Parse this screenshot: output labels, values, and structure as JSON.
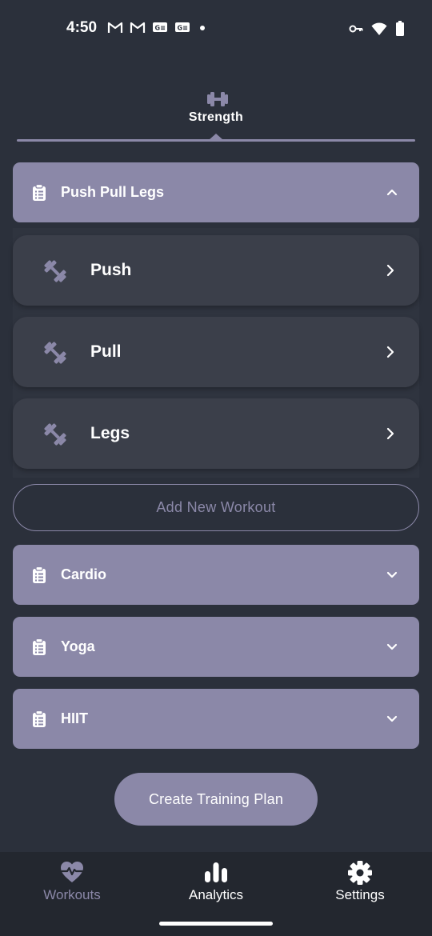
{
  "status_bar": {
    "time": "4:50",
    "notification_icons": [
      "gmail-icon",
      "gmail-icon",
      "news-icon",
      "news-icon",
      "dot-icon"
    ],
    "right_icons": [
      "vpn-key-icon",
      "wifi-icon",
      "battery-icon"
    ]
  },
  "tab": {
    "label": "Strength",
    "icon": "dumbbell-icon"
  },
  "plans": [
    {
      "label": "Push Pull Legs",
      "expanded": true,
      "workouts": [
        {
          "label": "Push"
        },
        {
          "label": "Pull"
        },
        {
          "label": "Legs"
        }
      ],
      "add_label": "Add New Workout"
    },
    {
      "label": "Cardio",
      "expanded": false
    },
    {
      "label": "Yoga",
      "expanded": false
    },
    {
      "label": "HIIT",
      "expanded": false
    }
  ],
  "create_plan_label": "Create Training Plan",
  "nav": {
    "items": [
      {
        "label": "Workouts",
        "icon": "heart-pulse-icon",
        "active": false
      },
      {
        "label": "Analytics",
        "icon": "bar-chart-icon",
        "active": true
      },
      {
        "label": "Settings",
        "icon": "gear-icon",
        "active": true
      }
    ]
  },
  "colors": {
    "background": "#2b303b",
    "accent": "#8b88a8",
    "card": "#3b3f4a",
    "nav_background": "#23272f"
  }
}
